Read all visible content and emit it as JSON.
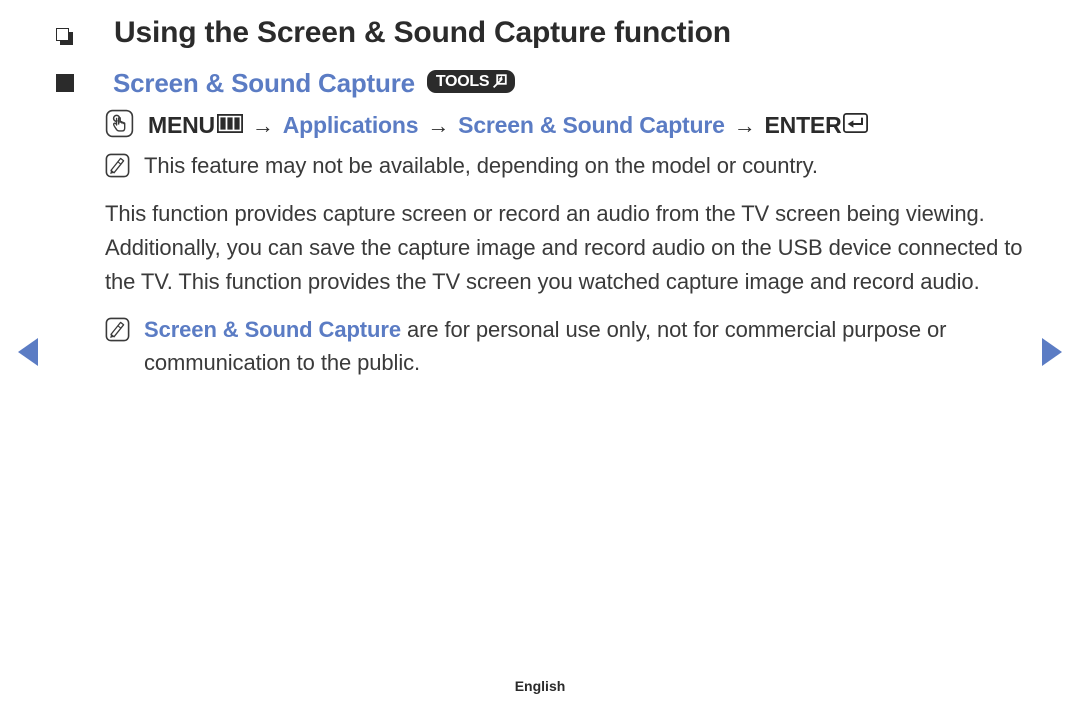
{
  "colors": {
    "accent_blue": "#5b7cc4",
    "text_dark": "#2b2b2b",
    "body_text": "#3a3a3a",
    "badge_bg": "#2b2b2b"
  },
  "nav": {
    "prev_label": "Previous page",
    "next_label": "Next page"
  },
  "heading": {
    "title": "Using the Screen & Sound Capture function"
  },
  "section": {
    "title": "Screen & Sound Capture",
    "badge": {
      "label": "TOOLS",
      "icon": "tools-arrow-icon"
    }
  },
  "menu_path": {
    "icon": "hand-press-icon",
    "step1": "MENU",
    "step1_icon": "menu-bars-icon",
    "arrow": "→",
    "step2": "Applications",
    "step3": "Screen & Sound Capture",
    "step4": "ENTER",
    "step4_icon": "enter-key-icon"
  },
  "note_top": {
    "icon": "note-pencil-icon",
    "text": "This feature may not be available, depending on the model or country."
  },
  "paragraph": {
    "text": "This function provides capture screen or record an audio from the TV screen being viewing. Additionally, you can save the capture image and record audio on the USB device connected to the TV. This function provides the TV screen you watched capture image and record audio."
  },
  "note_bottom": {
    "icon": "note-pencil-icon",
    "highlight": "Screen & Sound Capture",
    "text": " are for personal use only, not for commercial purpose or communication to the public."
  },
  "footer": {
    "language": "English"
  }
}
